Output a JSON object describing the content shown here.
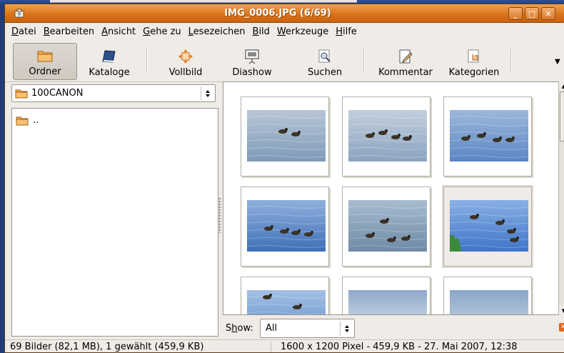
{
  "window": {
    "title": "IMG_0006.JPG  (6/69)",
    "controls": [
      "minimize",
      "maximize",
      "close"
    ]
  },
  "menu": [
    {
      "underline": "D",
      "rest": "atei"
    },
    {
      "underline": "B",
      "rest": "earbeiten"
    },
    {
      "underline": "A",
      "rest": "nsicht"
    },
    {
      "underline": "G",
      "rest": "ehe zu"
    },
    {
      "underline": "L",
      "rest": "esezeichen"
    },
    {
      "underline": "B",
      "rest": "ild"
    },
    {
      "underline": "W",
      "rest": "erkzeuge"
    },
    {
      "underline": "H",
      "rest": "ilfe"
    }
  ],
  "toolbar": {
    "folders": "Ordner",
    "catalogs": "Kataloge",
    "fullscreen": "Vollbild",
    "slideshow": "Diashow",
    "search": "Suchen",
    "comment": "Kommentar",
    "categories": "Kategorien"
  },
  "folder_combo": {
    "value": "100CANON"
  },
  "folder_list": [
    ".."
  ],
  "thumbnails": {
    "count_visible": 9,
    "selected_index": 5
  },
  "filter": {
    "label_underline": "h",
    "label_before": "S",
    "label_after": "ow:",
    "value": "All"
  },
  "status": {
    "left": "69 Bilder (82,1 MB), 1 gewählt (459,9 KB)",
    "right": "1600 x 1200 Pixel - 459,9 KB - 27. Mai 2007, 12:38"
  },
  "colors": {
    "titlebar": "#d9741c",
    "window_bg": "#efebe7",
    "folder_icon": "#f0a040"
  }
}
